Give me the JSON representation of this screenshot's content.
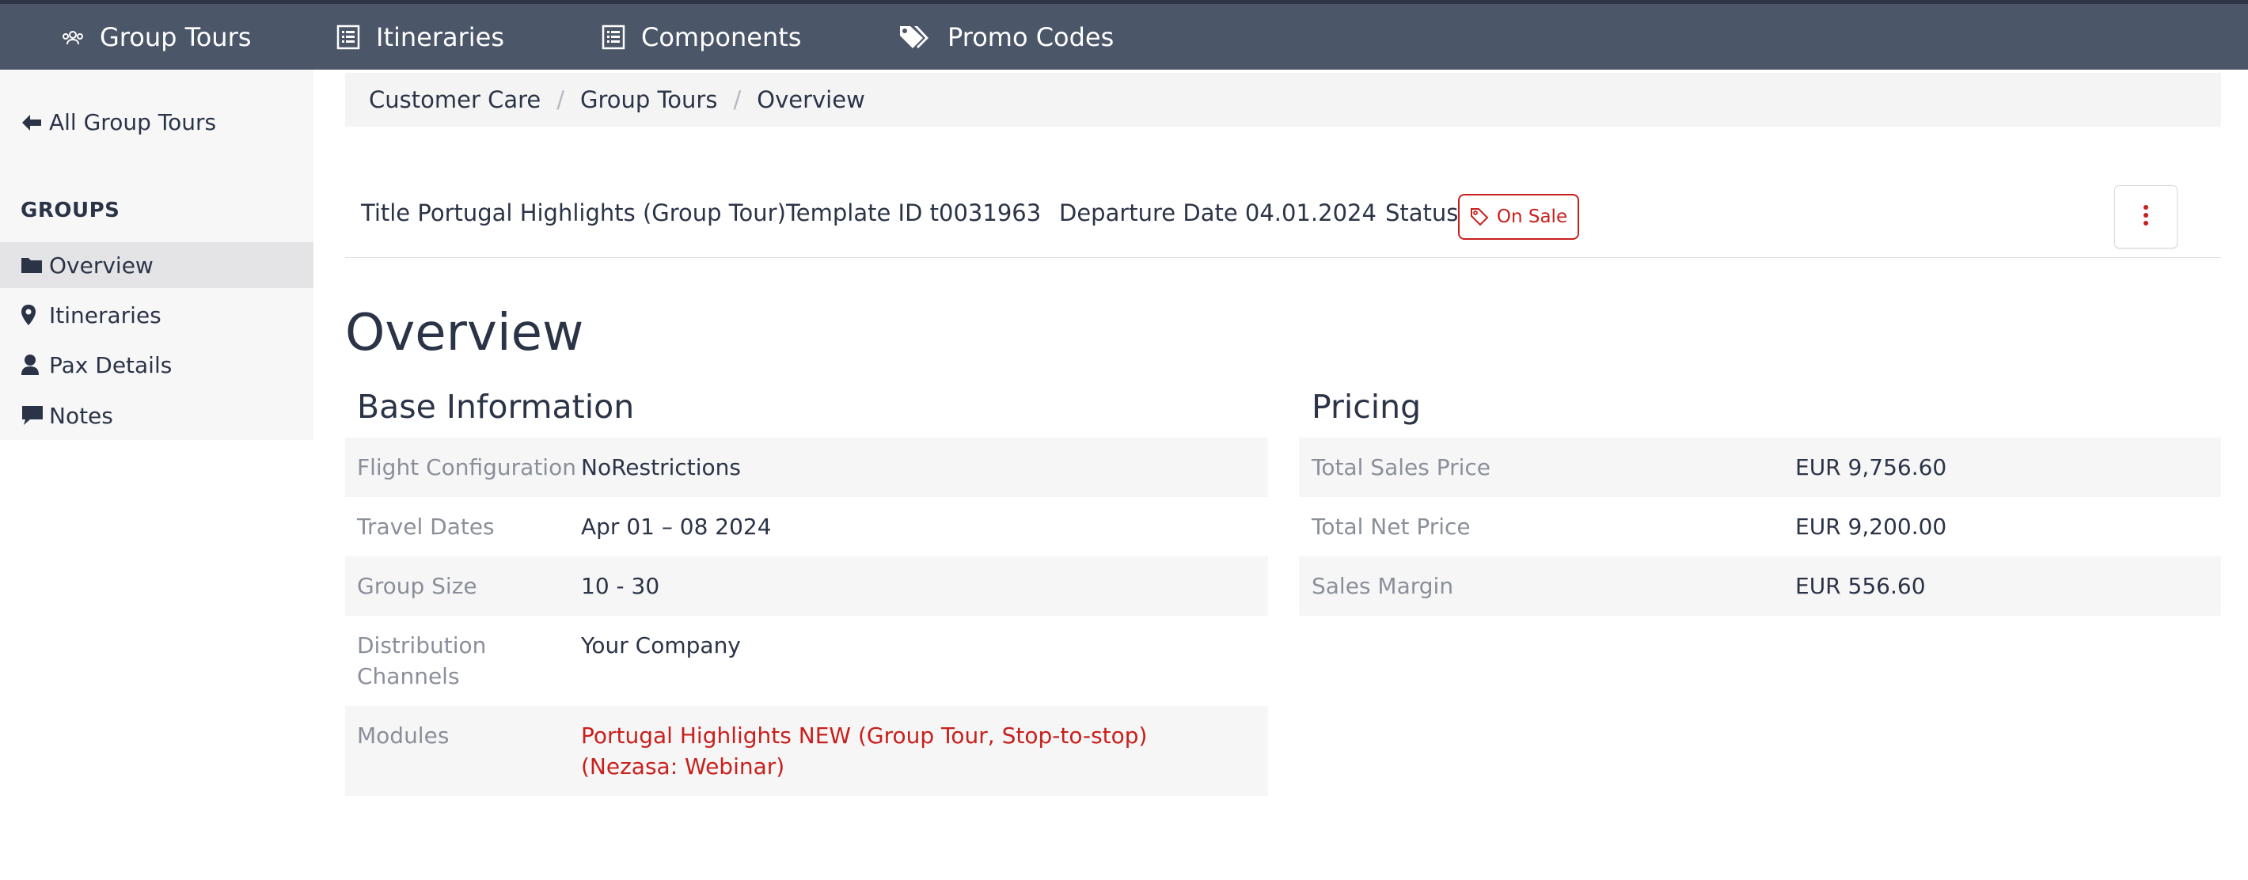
{
  "nav": {
    "items": [
      {
        "label": "Group Tours",
        "icon": "group-icon"
      },
      {
        "label": "Itineraries",
        "icon": "list-icon"
      },
      {
        "label": "Components",
        "icon": "list-icon"
      },
      {
        "label": "Promo Codes",
        "icon": "tags-icon"
      }
    ]
  },
  "sidebar": {
    "back_label": "All Group Tours",
    "heading": "GROUPS",
    "items": [
      {
        "label": "Overview",
        "icon": "folder-icon",
        "active": true
      },
      {
        "label": "Itineraries",
        "icon": "map-pin-icon"
      },
      {
        "label": "Pax Details",
        "icon": "user-icon"
      },
      {
        "label": "Notes",
        "icon": "comment-icon"
      }
    ]
  },
  "breadcrumb": [
    "Customer Care",
    "Group Tours",
    "Overview"
  ],
  "header": {
    "title": "Title Portugal Highlights (Group Tour)",
    "template": "Template ID t0031963",
    "departure": "Departure Date 04.01.2024",
    "status_label": "Status",
    "status_value": "On Sale"
  },
  "page_title": "Overview",
  "base_info": {
    "title": "Base Information",
    "rows": [
      {
        "label": "Flight Configuration",
        "value": "NoRestrictions"
      },
      {
        "label": "Travel Dates",
        "value": "Apr 01 – 08 2024"
      },
      {
        "label": "Group Size",
        "value": "10 - 30"
      },
      {
        "label": "Distribution Channels",
        "value": "Your Company"
      },
      {
        "label": "Modules",
        "value": "Portugal Highlights NEW (Group Tour, Stop-to-stop) (Nezasa: Webinar)"
      }
    ]
  },
  "pricing": {
    "title": "Pricing",
    "rows": [
      {
        "label": "Total Sales Price",
        "value": "EUR 9,756.60"
      },
      {
        "label": "Total Net Price",
        "value": "EUR 9,200.00"
      },
      {
        "label": "Sales Margin",
        "value": "EUR 556.60"
      }
    ]
  },
  "colors": {
    "nav_bg": "#4b5669",
    "accent": "#c8201c",
    "text": "#2b3447",
    "muted": "#8a8f99"
  }
}
